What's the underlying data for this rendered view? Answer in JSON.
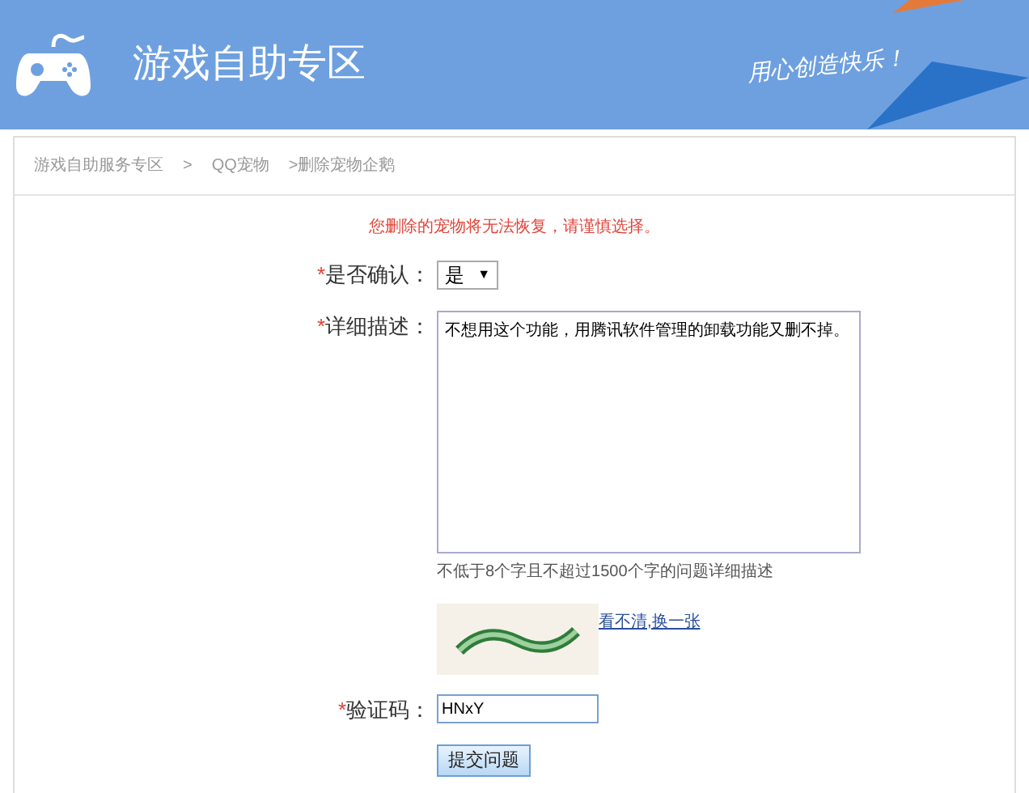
{
  "header": {
    "title": "游戏自助专区",
    "slogan": "用心创造快乐！"
  },
  "breadcrumb": [
    "游戏自助服务专区",
    ">",
    "QQ宠物",
    ">删除宠物企鹅"
  ],
  "warning": "您删除的宠物将无法恢复，请谨慎选择。",
  "form": {
    "confirm": {
      "required_mark": "*",
      "label": "是否确认：",
      "value": "是",
      "arrow": "▼"
    },
    "description": {
      "required_mark": "*",
      "label": "详细描述：",
      "value": "不想用这个功能，用腾讯软件管理的卸载功能又删不掉。",
      "hint": "不低于8个字且不超过1500个字的问题详细描述"
    },
    "captcha": {
      "refresh_link": "看不清,换一张"
    },
    "code": {
      "required_mark": "*",
      "label": "验证码：",
      "value": "HNxY"
    },
    "submit": "提交问题"
  }
}
